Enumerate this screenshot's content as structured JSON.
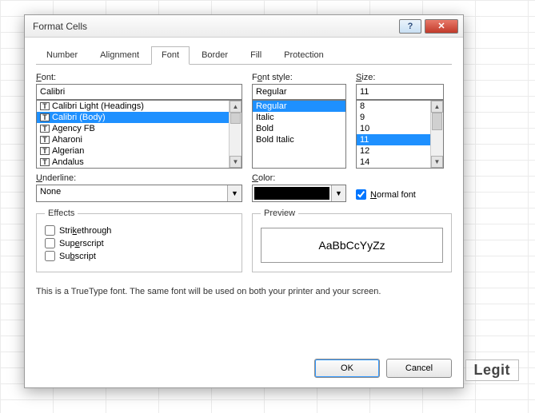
{
  "dialog": {
    "title": "Format Cells"
  },
  "tabs": {
    "items": [
      "Number",
      "Alignment",
      "Font",
      "Border",
      "Fill",
      "Protection"
    ],
    "active": 2
  },
  "font": {
    "label": "Font:",
    "value": "Calibri",
    "items": [
      "Calibri Light (Headings)",
      "Calibri (Body)",
      "Agency FB",
      "Aharoni",
      "Algerian",
      "Andalus"
    ],
    "selected": 1
  },
  "fontstyle": {
    "label": "Font style:",
    "value": "Regular",
    "items": [
      "Regular",
      "Italic",
      "Bold",
      "Bold Italic"
    ],
    "selected": 0
  },
  "size": {
    "label": "Size:",
    "value": "11",
    "items": [
      "8",
      "9",
      "10",
      "11",
      "12",
      "14"
    ],
    "selected": 3
  },
  "underline": {
    "label": "Underline:",
    "value": "None"
  },
  "color": {
    "label": "Color:",
    "value": "#000000"
  },
  "normalfont": {
    "label": "Normal font",
    "checked": true
  },
  "effects": {
    "legend": "Effects",
    "strike": "Strikethrough",
    "super": "Superscript",
    "sub": "Subscript"
  },
  "preview": {
    "legend": "Preview",
    "sample": "AaBbCcYyZz"
  },
  "footnote": "This is a TrueType font.  The same font will be used on both your printer and your screen.",
  "buttons": {
    "ok": "OK",
    "cancel": "Cancel"
  },
  "watermark": "Legit"
}
